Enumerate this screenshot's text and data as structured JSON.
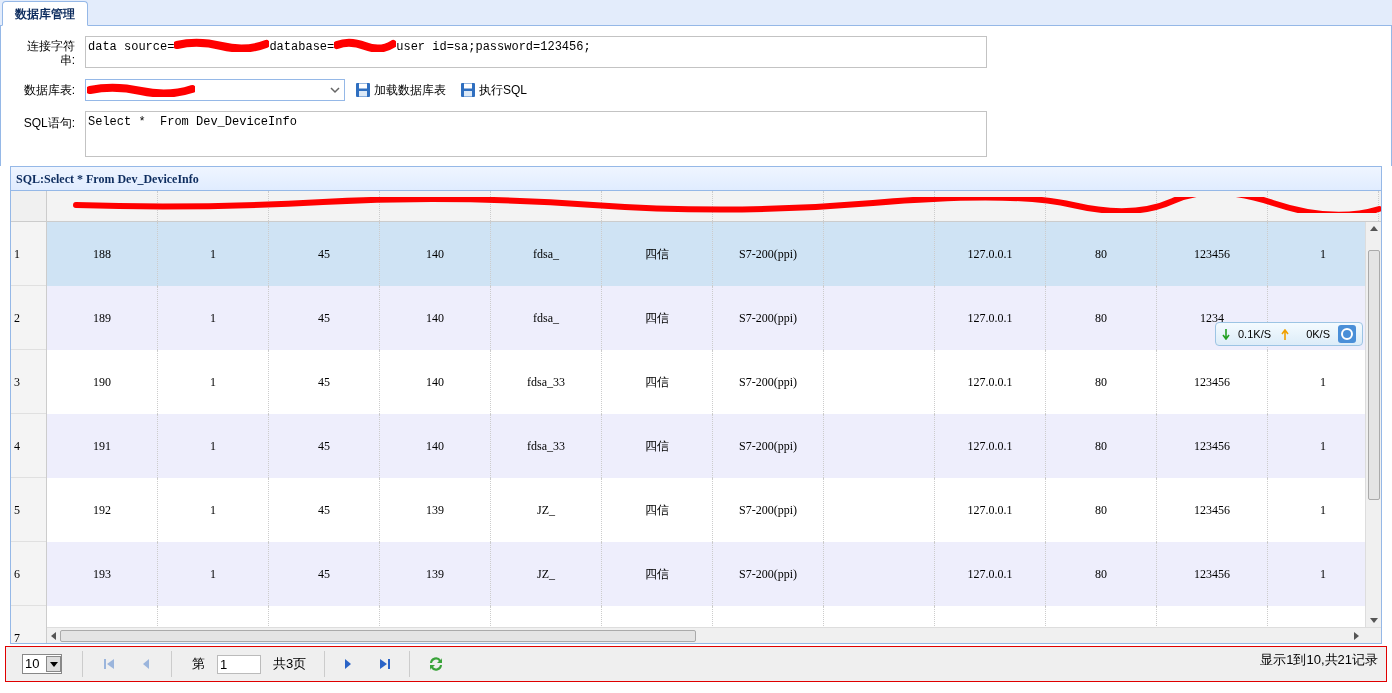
{
  "tab": {
    "label": "数据库管理",
    "selected": true
  },
  "form": {
    "connection_label": "连接字符串:",
    "connection_parts": [
      {
        "kind": "text",
        "text": "data source="
      },
      {
        "kind": "redacted"
      },
      {
        "kind": "text",
        "text": "database="
      },
      {
        "kind": "redacted"
      },
      {
        "kind": "text",
        "text": "user id=sa;password=123456;"
      }
    ],
    "table_label": "数据库表:",
    "table_value_redacted": true,
    "buttons": [
      "加载数据库表",
      "执行SQL"
    ],
    "sql_label": "SQL语句:",
    "sql_value": "Select *  From Dev_DeviceInfo"
  },
  "grid": {
    "title": "SQL:Select * From Dev_DeviceInfo",
    "header_redacted": true,
    "rows": [
      {
        "number": "1",
        "selected": true,
        "cells": [
          "188",
          "1",
          "45",
          "140",
          "fdsa_",
          "四信",
          "S7-200(ppi)",
          null,
          "127.0.0.1",
          "80",
          "123456",
          "1"
        ]
      },
      {
        "number": "2",
        "selected": false,
        "cells": [
          "189",
          "1",
          "45",
          "140",
          "fdsa_",
          "四信",
          "S7-200(ppi)",
          null,
          "127.0.0.1",
          "80",
          "1234",
          null
        ]
      },
      {
        "number": "3",
        "selected": false,
        "cells": [
          "190",
          "1",
          "45",
          "140",
          "fdsa_33",
          "四信",
          "S7-200(ppi)",
          null,
          "127.0.0.1",
          "80",
          "123456",
          "1"
        ]
      },
      {
        "number": "4",
        "selected": false,
        "cells": [
          "191",
          "1",
          "45",
          "140",
          "fdsa_33",
          "四信",
          "S7-200(ppi)",
          null,
          "127.0.0.1",
          "80",
          "123456",
          "1"
        ]
      },
      {
        "number": "5",
        "selected": false,
        "cells": [
          "192",
          "1",
          "45",
          "139",
          "JZ_",
          "四信",
          "S7-200(ppi)",
          null,
          "127.0.0.1",
          "80",
          "123456",
          "1"
        ]
      },
      {
        "number": "6",
        "selected": false,
        "cells": [
          "193",
          "1",
          "45",
          "139",
          "JZ_",
          "四信",
          "S7-200(ppi)",
          null,
          "127.0.0.1",
          "80",
          "123456",
          "1"
        ]
      },
      {
        "number": "7",
        "selected": false
      }
    ]
  },
  "pager": {
    "page_size": "10",
    "page_label": "第",
    "page_value": "1",
    "total_pages": "共3页",
    "summary": "显示1到10,共21记录"
  },
  "net_widget": {
    "download": "0.1K/S",
    "upload": "0K/S"
  }
}
